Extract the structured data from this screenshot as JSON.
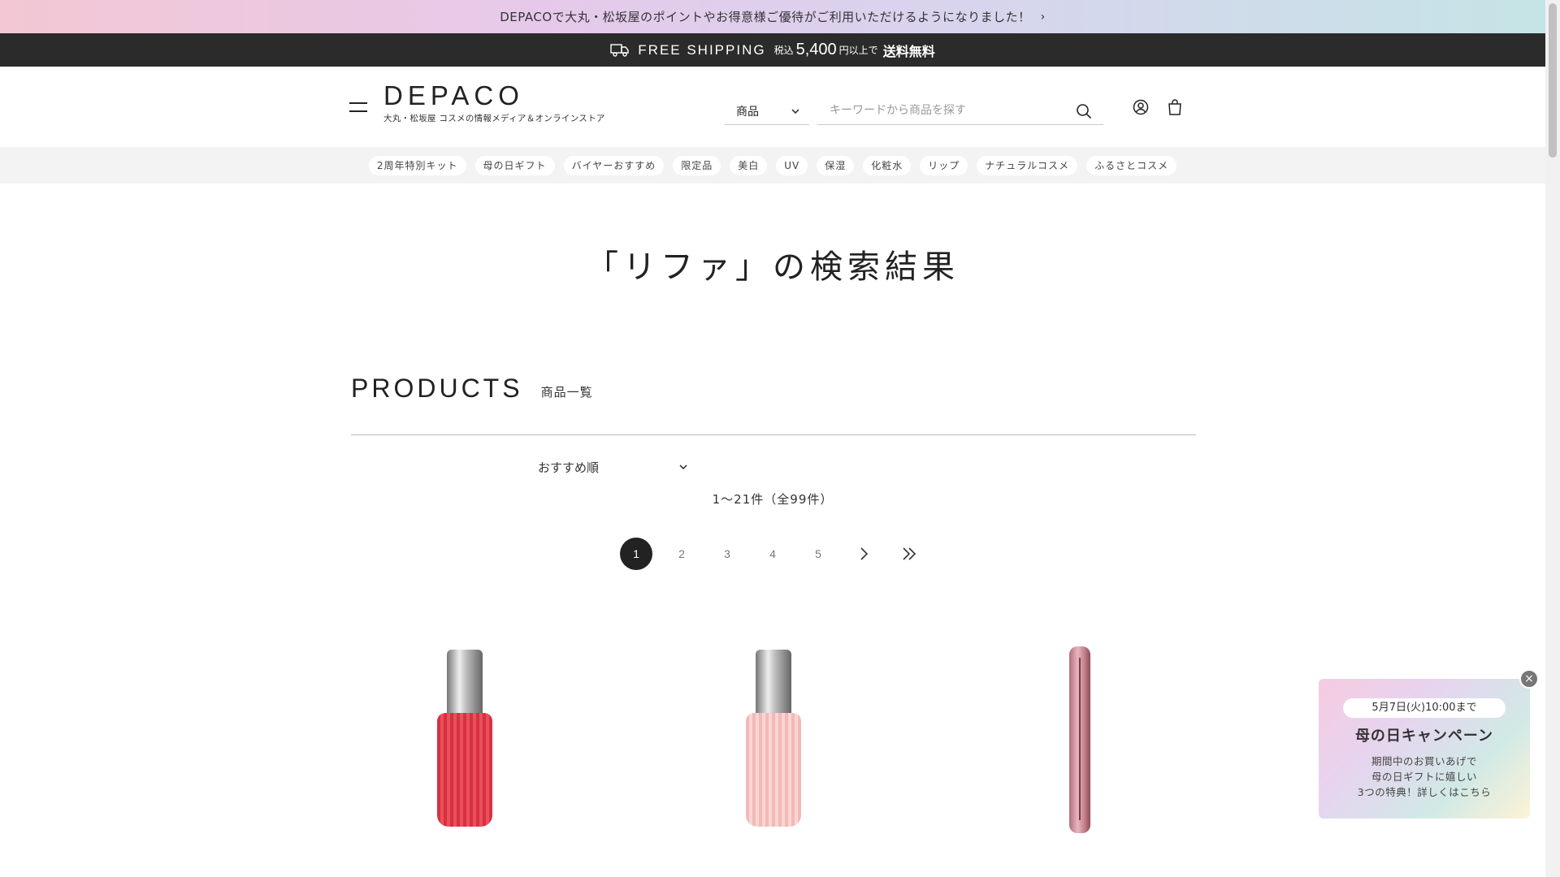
{
  "promo_bar": {
    "text": "DEPACOで大丸・松坂屋のポイントやお得意様ご優待がご利用いただけるようになりました！",
    "chevron": "›"
  },
  "shipping_bar": {
    "icon": "truck-icon",
    "label": "FREE SHIPPING",
    "tax_label": "税込",
    "amount": "5,400",
    "suffix": "円以上で",
    "emphasis": "送料無料"
  },
  "header": {
    "logo": "DEPACO",
    "tagline": "大丸・松坂屋 コスメの情報メディア＆オンラインストア",
    "search_category": "商品",
    "search_placeholder": "キーワードから商品を探す"
  },
  "tags": [
    "2周年特別キット",
    "母の日ギフト",
    "バイヤーおすすめ",
    "限定品",
    "美白",
    "UV",
    "保湿",
    "化粧水",
    "リップ",
    "ナチュラルコスメ",
    "ふるさとコスメ"
  ],
  "page_title": "「リファ」の検索結果",
  "products_section": {
    "title": "PRODUCTS",
    "subtitle": "商品一覧",
    "sort_label": "おすすめ順",
    "count_text": "1〜21件（全99件）"
  },
  "pagination": {
    "pages": [
      "1",
      "2",
      "3",
      "4",
      "5"
    ],
    "current": "1",
    "next": "›",
    "last": "»"
  },
  "campaign": {
    "badge": "5月7日(火)10:00まで",
    "title": "母の日キャンペーン",
    "line1": "期間中のお買いあげで",
    "line2": "母の日ギフトに嬉しい",
    "line3": "3つの特典！詳しくはこちら"
  },
  "colors": {
    "dark_bar": "#2b2b2b",
    "accent": "#222222",
    "tag_bg": "#f3f3f3"
  }
}
